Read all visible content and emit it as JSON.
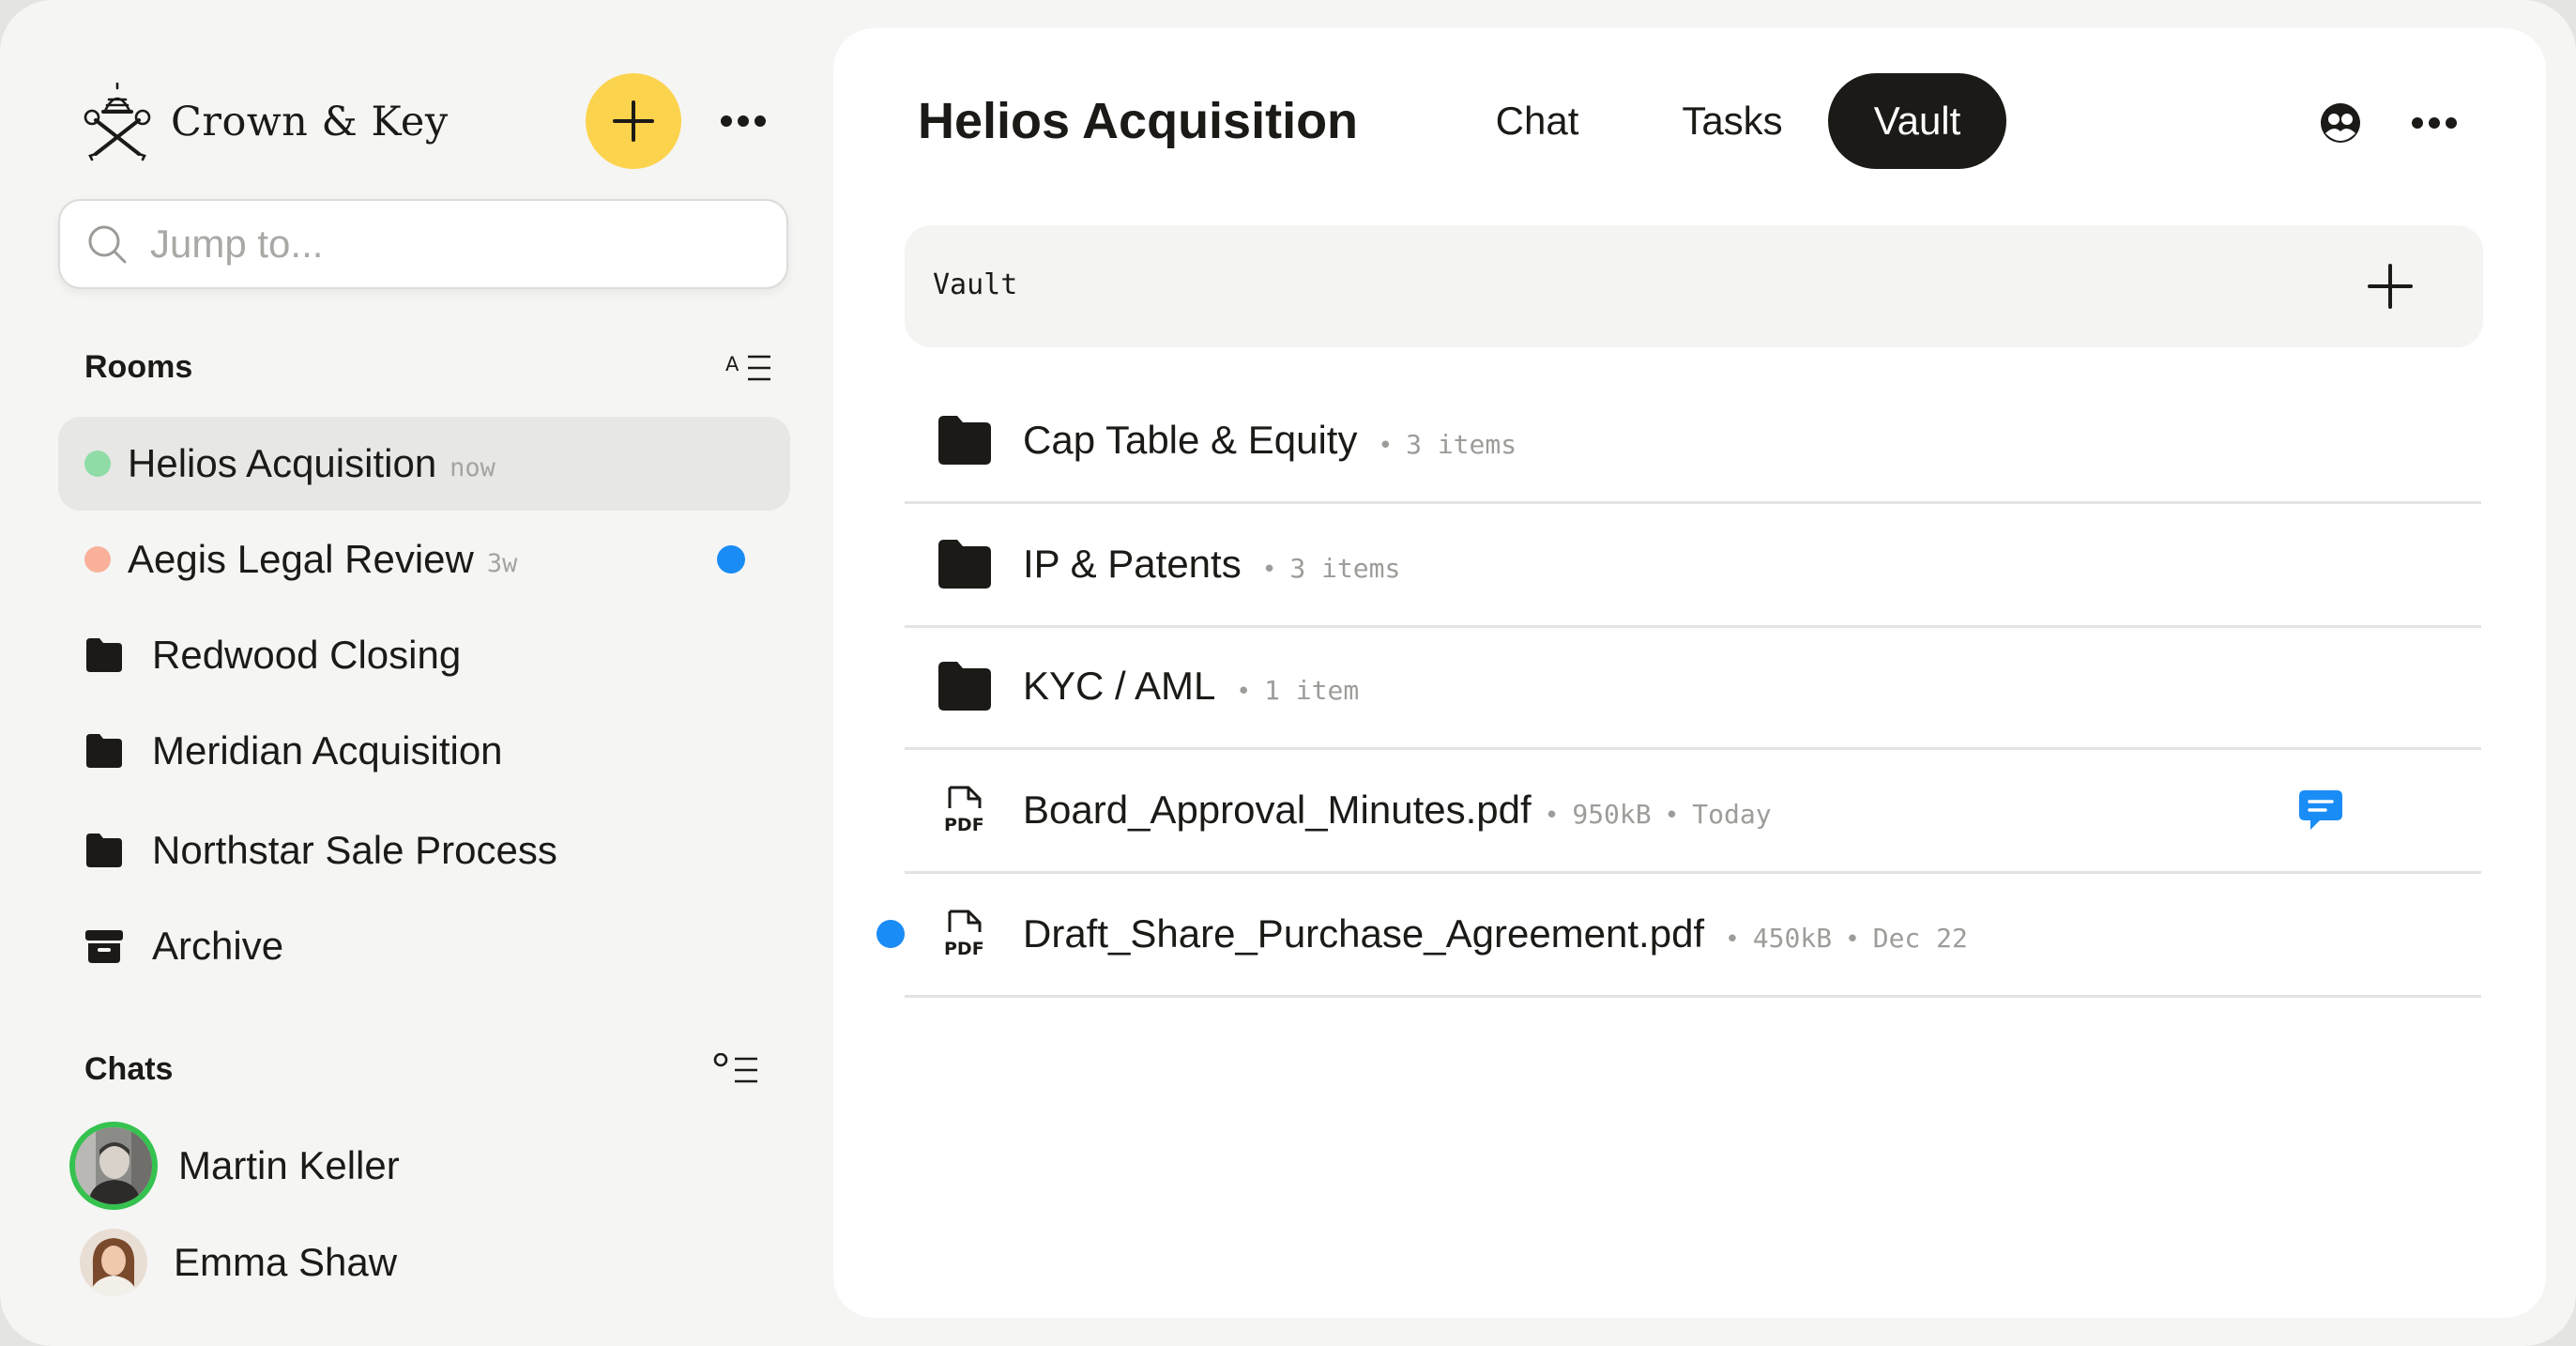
{
  "brand": {
    "name": "Crown & Key",
    "logo_icon": "crest-keys-icon"
  },
  "search": {
    "placeholder": "Jump to..."
  },
  "sections": {
    "rooms_label": "Rooms",
    "chats_label": "Chats"
  },
  "rooms": [
    {
      "name": "Helios Acquisition",
      "time": "now",
      "status_color": "#8fdca6",
      "active": true
    },
    {
      "name": "Aegis Legal Review",
      "time": "3w",
      "status_color": "#f9b19a",
      "unread": true
    }
  ],
  "folders": [
    {
      "name": "Redwood Closing"
    },
    {
      "name": "Meridian Acquisition"
    },
    {
      "name": "Northstar Sale Process"
    },
    {
      "name": "Archive"
    }
  ],
  "chats": [
    {
      "name": "Martin Keller",
      "online": true
    },
    {
      "name": "Emma Shaw"
    }
  ],
  "main": {
    "title": "Helios Acquisition",
    "tabs": [
      {
        "label": "Chat"
      },
      {
        "label": "Tasks"
      },
      {
        "label": "Vault",
        "active": true
      }
    ],
    "breadcrumb": "Vault",
    "items": [
      {
        "type": "folder",
        "name": "Cap Table & Equity",
        "meta": "3 items"
      },
      {
        "type": "folder",
        "name": "IP & Patents",
        "meta": "3 items"
      },
      {
        "type": "folder",
        "name": "KYC / AML",
        "meta": "1 item"
      },
      {
        "type": "pdf",
        "name": "Board_Approval_Minutes.pdf",
        "size": "950kB",
        "date": "Today",
        "has_comment": true
      },
      {
        "type": "pdf",
        "name": "Draft_Share_Purchase_Agreement.pdf",
        "size": "450kB",
        "date": "Dec 22",
        "unread": true
      }
    ]
  },
  "colors": {
    "accent": "#fcd34d",
    "unread": "#1a8cf5",
    "online_ring": "#35c24f",
    "ink": "#1c1a17"
  }
}
